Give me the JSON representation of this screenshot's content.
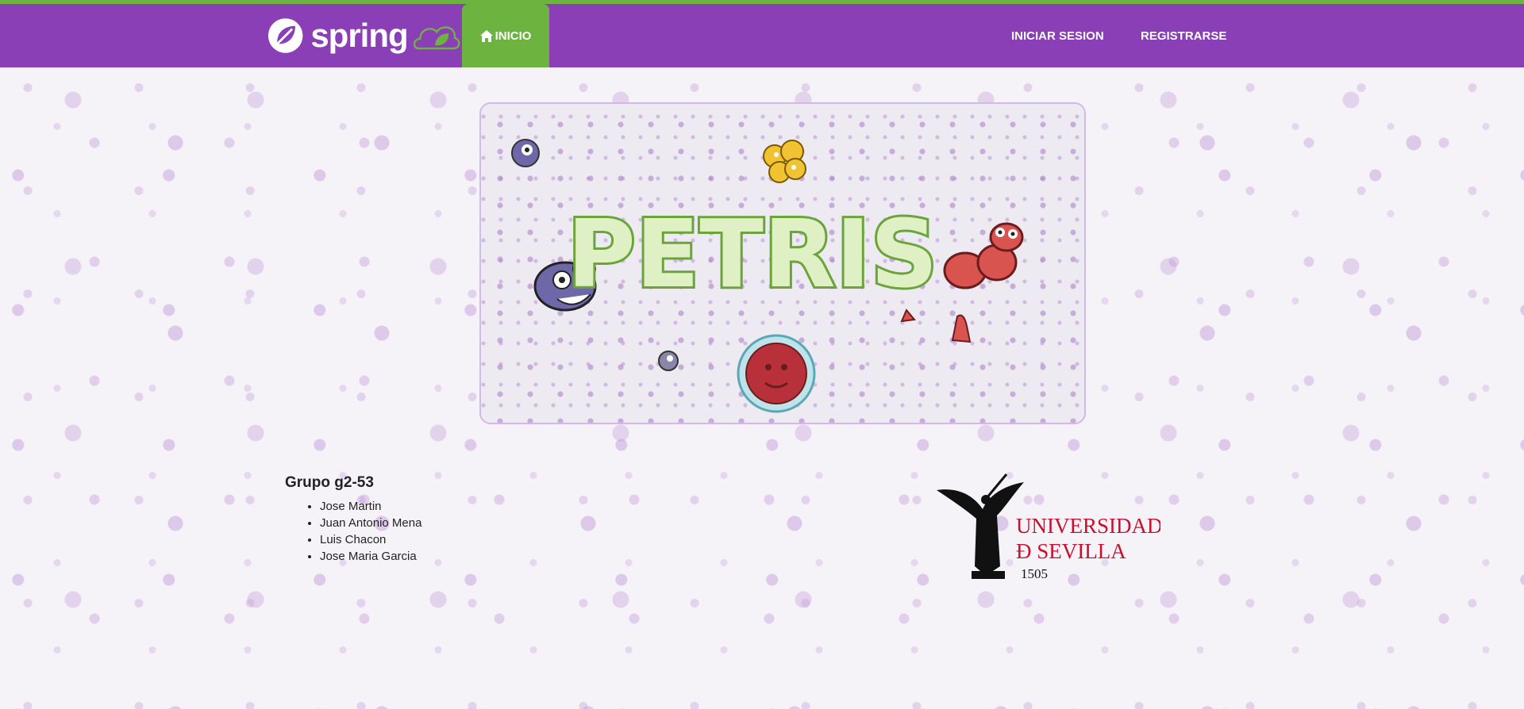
{
  "navbar": {
    "brand": "spring",
    "home_label": "INICIO",
    "login_label": "INICIAR SESION",
    "register_label": "REGISTRARSE"
  },
  "banner": {
    "title": "PETRIS"
  },
  "team": {
    "title": "Grupo g2-53",
    "members": [
      "Jose Martin",
      "Juan Antonio Mena",
      "Luis Chacon",
      "Jose Maria Garcia"
    ]
  },
  "university": {
    "line1": "UNIVERSIDAD",
    "line2": "Ð SEVILLA",
    "year": "1505"
  },
  "colors": {
    "navbar": "#8a3fb7",
    "accent_green": "#6db33f",
    "banner_border": "#d3b9ea",
    "university_red": "#c8102e"
  },
  "icons": {
    "brand": "spring-leaf-icon",
    "home": "home-icon"
  }
}
